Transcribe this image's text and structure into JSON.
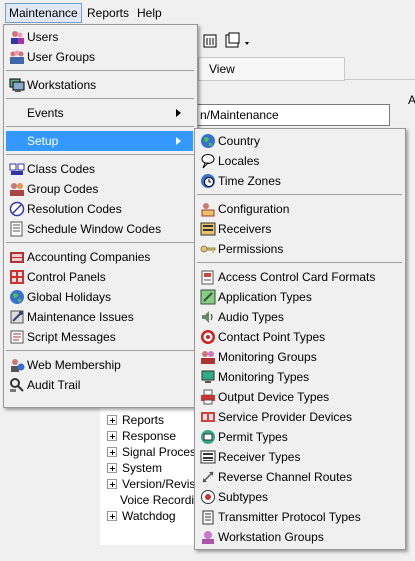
{
  "menubar": {
    "maintenance": "Maintenance",
    "reports": "Reports",
    "help": "Help"
  },
  "tab": {
    "view": "View"
  },
  "path_field": {
    "value": "n/Maintenance"
  },
  "right_edge_label": "A",
  "tree": [
    "Reports",
    "Response",
    "Signal Processin",
    "System",
    "Version/Revisio",
    "Voice Recording",
    "Watchdog"
  ],
  "maintenance_menu": [
    {
      "label": "Users",
      "icon": "users-icon"
    },
    {
      "label": "User Groups",
      "icon": "user-groups-icon"
    },
    {
      "label": "Workstations",
      "icon": "workstations-icon"
    },
    {
      "label": "Events",
      "icon": "none"
    },
    {
      "label": "Setup",
      "icon": "none"
    },
    {
      "label": "Class Codes",
      "icon": "class-codes-icon"
    },
    {
      "label": "Group Codes",
      "icon": "group-codes-icon"
    },
    {
      "label": "Resolution Codes",
      "icon": "resolution-codes-icon"
    },
    {
      "label": "Schedule Window Codes",
      "icon": "schedule-window-icon"
    },
    {
      "label": "Accounting Companies",
      "icon": "accounting-icon"
    },
    {
      "label": "Control Panels",
      "icon": "control-panels-icon"
    },
    {
      "label": "Global Holidays",
      "icon": "globe-icon"
    },
    {
      "label": "Maintenance Issues",
      "icon": "maintenance-issues-icon"
    },
    {
      "label": "Script Messages",
      "icon": "script-icon"
    },
    {
      "label": "Web Membership",
      "icon": "web-icon"
    },
    {
      "label": "Audit Trail",
      "icon": "audit-trail-icon"
    }
  ],
  "setup_menu": [
    {
      "label": "Country",
      "icon": "globe-icon"
    },
    {
      "label": "Locales",
      "icon": "locales-icon"
    },
    {
      "label": "Time Zones",
      "icon": "time-zones-icon"
    },
    {
      "label": "Configuration",
      "icon": "configuration-icon"
    },
    {
      "label": "Receivers",
      "icon": "receivers-icon"
    },
    {
      "label": "Permissions",
      "icon": "key-icon"
    },
    {
      "label": "Access Control Card Formats",
      "icon": "card-icon"
    },
    {
      "label": "Application Types",
      "icon": "application-icon"
    },
    {
      "label": "Audio Types",
      "icon": "audio-icon"
    },
    {
      "label": "Contact Point Types",
      "icon": "target-icon"
    },
    {
      "label": "Monitoring Groups",
      "icon": "monitoring-groups-icon"
    },
    {
      "label": "Monitoring Types",
      "icon": "monitor-icon"
    },
    {
      "label": "Output Device Types",
      "icon": "printer-icon"
    },
    {
      "label": "Service Provider Devices",
      "icon": "service-icon"
    },
    {
      "label": "Permit Types",
      "icon": "permit-icon"
    },
    {
      "label": "Receiver Types",
      "icon": "receiver-types-icon"
    },
    {
      "label": "Reverse Channel Routes",
      "icon": "routes-icon"
    },
    {
      "label": "Subtypes",
      "icon": "subtypes-icon"
    },
    {
      "label": "Transmitter Protocol Types",
      "icon": "transmitter-icon"
    },
    {
      "label": "Workstation Groups",
      "icon": "workstation-groups-icon"
    }
  ],
  "colors": {
    "highlight": "#3399ff",
    "menu_bg": "#f0f0f0"
  }
}
